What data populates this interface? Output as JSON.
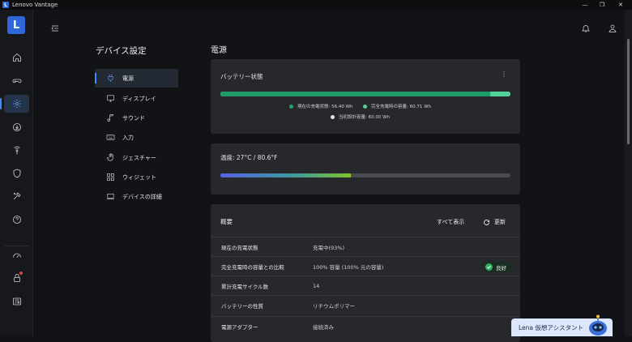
{
  "window": {
    "title": "Lenovo Vantage",
    "logo_letter": "L"
  },
  "rail": {
    "logo_letter": "L",
    "items": [
      {
        "icon": "home-icon"
      },
      {
        "icon": "gamepad-icon"
      },
      {
        "icon": "gear-icon",
        "active": true
      },
      {
        "icon": "download-icon"
      },
      {
        "icon": "wifi-security-icon"
      },
      {
        "icon": "shield-icon"
      },
      {
        "icon": "tools-icon"
      },
      {
        "icon": "help-icon"
      },
      {
        "icon": "speedometer-icon"
      },
      {
        "icon": "lock-icon"
      },
      {
        "icon": "news-icon"
      }
    ]
  },
  "menu": {
    "title": "デバイス設定",
    "items": [
      {
        "label": "電源",
        "icon": "power-plug-icon",
        "active": true
      },
      {
        "label": "ディスプレイ",
        "icon": "monitor-icon"
      },
      {
        "label": "サウンド",
        "icon": "music-note-icon"
      },
      {
        "label": "入力",
        "icon": "keyboard-icon"
      },
      {
        "label": "ジェスチャー",
        "icon": "hand-gesture-icon"
      },
      {
        "label": "ウィジェット",
        "icon": "widgets-icon"
      },
      {
        "label": "デバイスの詳細",
        "icon": "laptop-icon"
      }
    ]
  },
  "main": {
    "page_title": "電源",
    "battery": {
      "title": "バッテリー状態",
      "current_fraction": 0.9305,
      "legend": [
        {
          "label": "現在の充電状態: 56.40 Wh",
          "color": "#1fa46e"
        },
        {
          "label": "完全充電時の容量: 60.71 Wh",
          "color": "#4fd39a"
        },
        {
          "label": "当初設計容量: 60.00 Wh",
          "color": "#e4e4e4"
        }
      ]
    },
    "temperature": {
      "label": "温度: 27°C / 80.6°F",
      "fraction": 0.45
    },
    "summary": {
      "title": "概要",
      "show_all": "すべて表示",
      "refresh": "更新",
      "rows": [
        {
          "key": "現在の充電状態",
          "value": "充電中(93%)"
        },
        {
          "key": "完全充電時の容量との比較",
          "value": "100% 容量 (100% 元の容量)",
          "badge": "良好"
        },
        {
          "key": "累計充電サイクル数",
          "value": "14"
        },
        {
          "key": "バッテリーの性質",
          "value": "リチウムポリマー"
        },
        {
          "key": "電源アダプター",
          "value": "接続済み"
        }
      ]
    }
  },
  "assistant": {
    "label": "Lena 仮想アシスタント"
  },
  "colors": {
    "accent": "#3c8bff",
    "good": "#2fb25e",
    "battery_fill": "#1e9b66",
    "battery_capacity": "#4fd39a"
  }
}
